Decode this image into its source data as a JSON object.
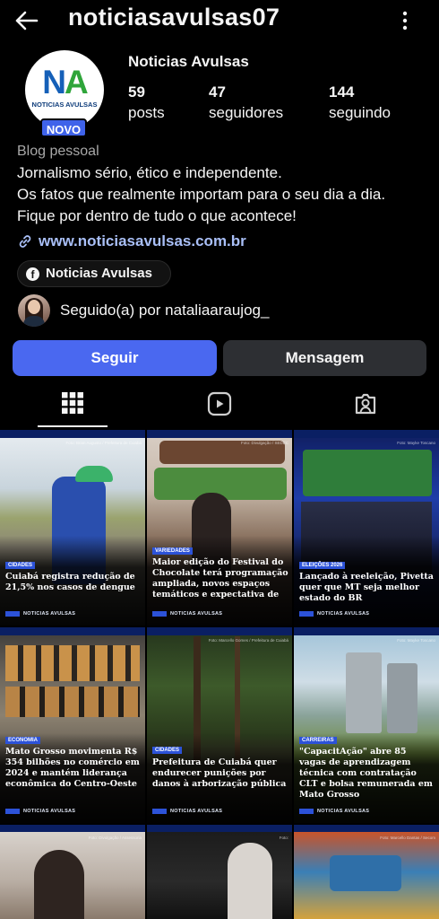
{
  "header": {
    "username": "noticiasavulsas07"
  },
  "profile": {
    "logo_letters": "NA",
    "logo_sub": "NOTICIAS AVULSAS",
    "badge": "NOVO",
    "display_name": "Noticias Avulsas",
    "stats": [
      {
        "value": "59",
        "label": "posts"
      },
      {
        "value": "47",
        "label": "seguidores"
      },
      {
        "value": "144",
        "label": "seguindo"
      }
    ],
    "category": "Blog pessoal",
    "bio": [
      "Jornalismo sério, ético e independente.",
      "Os fatos que realmente importam para o seu dia a dia.",
      "Fique por dentro de tudo o que acontece!"
    ],
    "link": "www.noticiasavulsas.com.br",
    "facebook_chip": "Noticias Avulsas",
    "followed_by": "Seguido(a) por nataliaaraujog_"
  },
  "actions": {
    "follow": "Seguir",
    "message": "Mensagem"
  },
  "tabs": [
    "grid-icon",
    "reels-icon",
    "tagged-icon"
  ],
  "posts": [
    {
      "tag": "CIDADES",
      "headline": "Cuiabá registra redução de 21,5% nos casos de dengue",
      "footer": "NOTICIAS AVULSAS",
      "credit": "Foto: Brian Augusto / Prefeitura de Cuiabá"
    },
    {
      "tag": "VARIEDADES",
      "headline": "Maior edição do Festival do Chocolate terá programação ampliada, novos espaços temáticos e expectativa de",
      "footer": "NOTICIAS AVULSAS",
      "credit": "Foto: Divulgação / SEDEC"
    },
    {
      "tag": "ELEIÇÕES 2026",
      "headline": "Lançado à reeleição, Pivetta quer que MT seja melhor estado do BR",
      "footer": "NOTICIAS AVULSAS",
      "credit": "Foto: Mayke Toscano"
    },
    {
      "tag": "ECONOMIA",
      "headline": "Mato Grosso movimenta R$ 354 bilhões no comércio em 2024 e mantém liderança econômica do Centro-Oeste",
      "footer": "NOTICIAS AVULSAS",
      "credit": ""
    },
    {
      "tag": "CIDADES",
      "headline": "Prefeitura de Cuiabá quer endurecer punições por danos à arborização pública",
      "footer": "NOTICIAS AVULSAS",
      "credit": "Foto: Marcello Gomes / Prefeitura de Cuiabá"
    },
    {
      "tag": "CARREIRAS",
      "headline": "\"CapacitAção\" abre 85 vagas de aprendizagem técnica com contratação CLT e bolsa remunerada em Mato Grosso",
      "footer": "NOTICIAS AVULSAS",
      "credit": "Foto: Mayke Toscano"
    },
    {
      "tag": "",
      "headline": "",
      "footer": "",
      "credit": "Foto: Divulgação / Assessoria"
    },
    {
      "tag": "",
      "headline": "",
      "footer": "",
      "credit": "Foto:"
    },
    {
      "tag": "",
      "headline": "",
      "footer": "",
      "credit": "Foto: Marcello Dantas / Secom"
    }
  ],
  "colors": {
    "accent_blue": "#4a68f0",
    "link_blue": "#a9bff7",
    "tag_blue": "#2c52d8"
  }
}
